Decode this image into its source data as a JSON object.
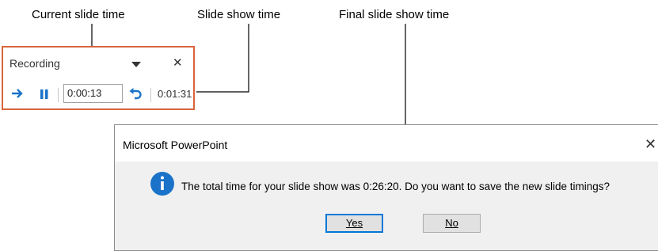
{
  "callouts": {
    "current_slide_time": "Current slide time",
    "slide_show_time": "Slide show time",
    "final_slide_show_time": "Final slide show time"
  },
  "recording_toolbar": {
    "title": "Recording",
    "current_time": "0:00:13",
    "total_time": "0:01:31",
    "accent_color": "#d8653b",
    "icons": [
      "next-arrow-icon",
      "pause-icon",
      "dropdown-icon",
      "close-icon",
      "repeat-icon"
    ]
  },
  "dialog": {
    "title": "Microsoft PowerPoint",
    "message": "The total time for your slide show was 0:26:20. Do you want to save the new slide timings?",
    "yes_label": "Yes",
    "no_label": "No",
    "icon": "info-icon",
    "icon_color": "#1a73c8"
  }
}
